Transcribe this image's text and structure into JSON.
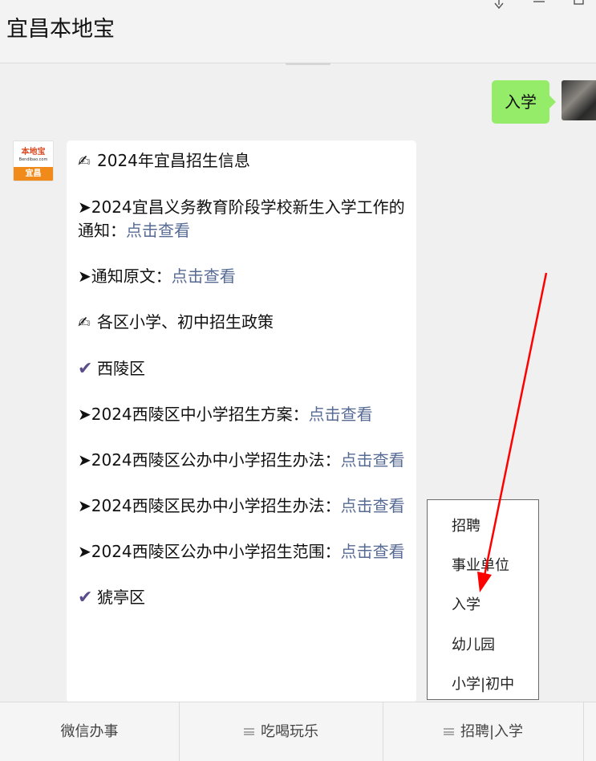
{
  "header": {
    "title": "宜昌本地宝",
    "pin_icon": "pin-icon",
    "minimize_icon": "minimize-icon",
    "maximize_icon": "maximize-icon"
  },
  "user_message": {
    "text": "入学"
  },
  "bot_avatar": {
    "top_text": "本地宝",
    "mid_text": "Bendibao.com",
    "bottom_text": "宜昌"
  },
  "bot_message": {
    "line1": {
      "icon": "writing-hand-icon",
      "text": "2024年宜昌招生信息"
    },
    "line2": {
      "text": "➤2024宜昌义务教育阶段学校新生入学工作的通知：",
      "link": "点击查看"
    },
    "line3": {
      "text": "➤通知原文：",
      "link": "点击查看"
    },
    "line4": {
      "icon": "writing-hand-icon",
      "text": "各区小学、初中招生政策"
    },
    "line5": {
      "icon": "check-mark-icon",
      "text": "西陵区"
    },
    "line6": {
      "text": "➤2024西陵区中小学招生方案：",
      "link": "点击查看"
    },
    "line7": {
      "text": "➤2024西陵区公办中小学招生办法：",
      "link": "点击查看"
    },
    "line8": {
      "text": "➤2024西陵区民办中小学招生办法：",
      "link": "点击查看"
    },
    "line9": {
      "text": "➤2024西陵区公办中小学招生范围：",
      "link": "点击查看"
    },
    "line10": {
      "icon": "check-mark-icon",
      "text": "猇亭区"
    }
  },
  "popup_menu": {
    "items": [
      "招聘",
      "事业单位",
      "入学",
      "幼儿园",
      "小学|初中"
    ]
  },
  "bottom_bar": {
    "tabs": [
      "微信办事",
      "吃喝玩乐",
      "招聘|入学"
    ]
  },
  "colors": {
    "user_bubble": "#95ec69",
    "link": "#576b95",
    "annotation_arrow": "#ff0000"
  }
}
